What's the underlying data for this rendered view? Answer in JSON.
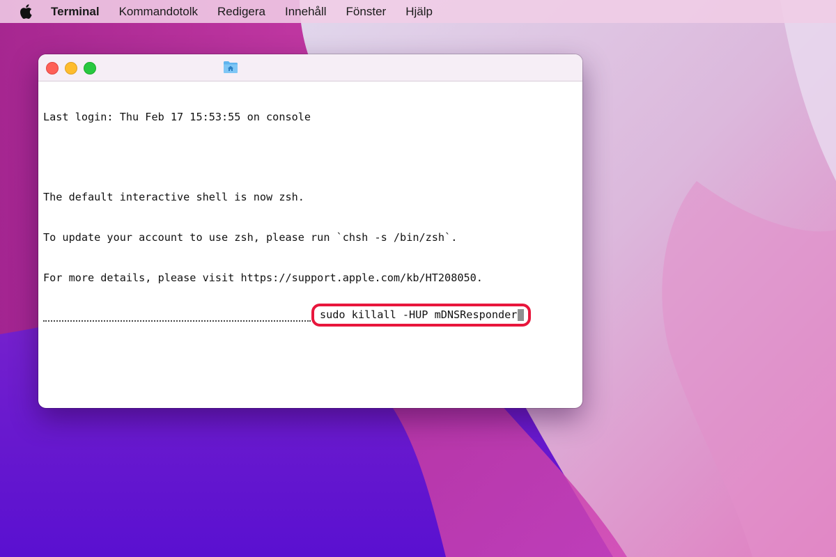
{
  "menubar": {
    "apple_icon": "apple-logo-icon",
    "app_name": "Terminal",
    "items": [
      "Kommandotolk",
      "Redigera",
      "Innehåll",
      "Fönster",
      "Hjälp"
    ]
  },
  "window": {
    "title_icon": "home-folder-icon",
    "lines": [
      "Last login: Thu Feb 17 15:53:55 on console",
      "",
      "The default interactive shell is now zsh.",
      "To update your account to use zsh, please run `chsh -s /bin/zsh`.",
      "For more details, please visit https://support.apple.com/kb/HT208050."
    ],
    "command": "sudo killall -HUP mDNSResponder"
  },
  "colors": {
    "highlight": "#e8163c",
    "close": "#fe5f57",
    "minimize": "#febc2e",
    "zoom": "#28c840"
  }
}
